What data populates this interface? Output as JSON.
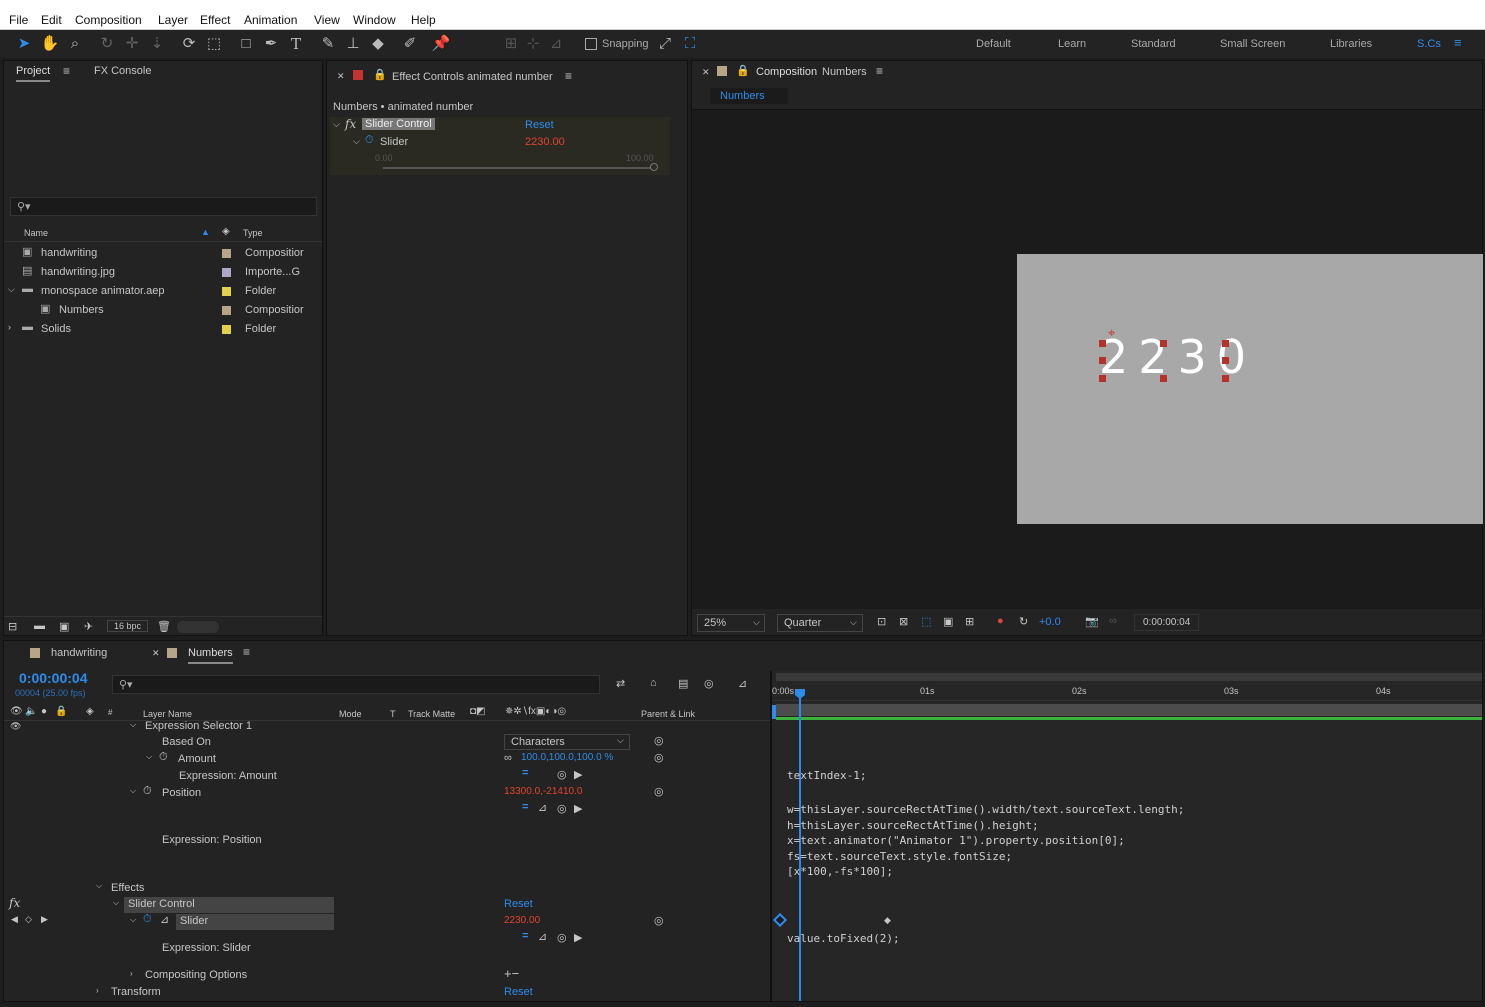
{
  "menu": [
    "File",
    "Edit",
    "Composition",
    "Layer",
    "Effect",
    "Animation",
    "View",
    "Window",
    "Help"
  ],
  "toolbar": {
    "snapping_label": "Snapping",
    "workspaces": [
      "Default",
      "Learn",
      "Standard",
      "Small Screen",
      "Libraries",
      "S.Cs"
    ]
  },
  "project": {
    "tabs": [
      "Project",
      "FX Console"
    ],
    "search_placeholder": "",
    "col_name": "Name",
    "col_type": "Type",
    "items": [
      {
        "name": "handwriting",
        "type": "Compositior",
        "color": "#b7a58a",
        "icon": "composition-icon"
      },
      {
        "name": "handwriting.jpg",
        "type": "Importe...G",
        "color": "#b0a6c6",
        "icon": "image-file-icon"
      },
      {
        "name": "monospace animator.aep",
        "type": "Folder",
        "color": "#e1d14f",
        "icon": "folder-icon"
      },
      {
        "name": "Numbers",
        "type": "Compositior",
        "color": "#b7a58a",
        "icon": "composition-icon"
      },
      {
        "name": "Solids",
        "type": "Folder",
        "color": "#e1d14f",
        "icon": "folder-icon"
      }
    ],
    "bpc": "16 bpc"
  },
  "effect_controls": {
    "title": "Effect Controls",
    "title_layer": "animated number",
    "breadcrumb": "Numbers • animated number",
    "effect_name": "Slider Control",
    "reset": "Reset",
    "param": "Slider",
    "param_value": "2230.00",
    "slider_min": "0.00",
    "slider_max": "100.00"
  },
  "composition": {
    "title": "Composition",
    "comp_name": "Numbers",
    "tab": "Numbers",
    "display_text": "2230",
    "zoom": "25%",
    "resolution": "Quarter",
    "exposure": "+0.0",
    "timecode": "0:00:00:04"
  },
  "timeline": {
    "tabs": [
      "handwriting",
      "Numbers"
    ],
    "timecode": "0:00:00:04",
    "frame_info": "00004 (25.00 fps)",
    "headers": {
      "layer_name": "Layer Name",
      "mode": "Mode",
      "t": "T",
      "track_matte": "Track Matte",
      "parent": "Parent & Link"
    },
    "ruler": [
      "0:00s",
      "01s",
      "02s",
      "03s",
      "04s"
    ],
    "rows": {
      "expr_selector": "Expression Selector 1",
      "based_on": "Based On",
      "based_on_value": "Characters",
      "amount": "Amount",
      "amount_value": "100.0,100.0,100.0 %",
      "expr_amount": "Expression: Amount",
      "position": "Position",
      "position_value": "13300.0,-21410.0",
      "expr_position": "Expression: Position",
      "effects": "Effects",
      "slider_control": "Slider Control",
      "reset": "Reset",
      "slider": "Slider",
      "slider_value": "2230.00",
      "expr_slider": "Expression: Slider",
      "compositing": "Compositing Options",
      "transform": "Transform",
      "transform_reset": "Reset"
    },
    "code_amount": "textIndex-1;",
    "code_position": [
      "w=thisLayer.sourceRectAtTime().width/text.sourceText.length;",
      "h=thisLayer.sourceRectAtTime().height;",
      "x=text.animator(\"Animator 1\").property.position[0];",
      "fs=text.sourceText.style.fontSize;",
      "[x*100,-fs*100];"
    ],
    "code_slider": "value.toFixed(2);"
  },
  "colors": {
    "accent": "#2d8ceb",
    "value_red": "#e0452f",
    "bg": "#232323"
  }
}
